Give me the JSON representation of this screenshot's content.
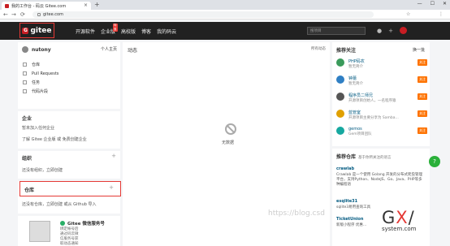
{
  "browser": {
    "tab_title": "我的工作台 - 码云 Gitee.com",
    "tab_close": "×",
    "new_tab": "+",
    "url": "gitee.com",
    "back": "←",
    "forward": "→",
    "reload": "⟳",
    "win_min": "—",
    "win_max": "☐",
    "win_close": "✕",
    "star": "☆",
    "menu": "⋮"
  },
  "header": {
    "logo_text": "gitee",
    "logo_mark": "G",
    "nav": [
      "开源软件",
      "企业版",
      "高校版",
      "博客",
      "我的码云"
    ],
    "hot_badge": "特惠",
    "search_placeholder": "搜项目",
    "bell": "🔔",
    "add": "+"
  },
  "user": {
    "name": "nutony",
    "home_link": "个人主页",
    "items": [
      "仓库",
      "Pull Requests",
      "任务",
      "代码片段"
    ]
  },
  "enterprise": {
    "title": "企业",
    "empty": "暂未加入任何企业",
    "promo": "了解 Gitee 企业版 或 免费创建企业"
  },
  "org": {
    "title": "组织",
    "empty": "还没有组织，立即创建"
  },
  "repo": {
    "title": "仓库",
    "empty": "还没有仓库，立即创建 或从 Github 导入"
  },
  "wechat": {
    "title": "Gitee 微信服务号",
    "lines": [
      "绑定帐号后",
      "通过码云微",
      "信服务号获",
      "取动态通知"
    ]
  },
  "center": {
    "title": "动态",
    "filter": "所有动态",
    "empty": "无数据",
    "watermark": "https://blog.csd"
  },
  "recommend": {
    "title": "推荐关注",
    "refresh": "换一批",
    "follow": "关注",
    "users": [
      {
        "name": "PHP码农",
        "desc": "暂无简介",
        "color": "#3a9a5b"
      },
      {
        "name": "钟蕾",
        "desc": "暂无简介",
        "color": "#2f7fc4"
      },
      {
        "name": "程序员二师兄",
        "desc": "开源项目创始人，一名程序猿",
        "color": "#555555"
      },
      {
        "name": "蓝管室",
        "desc": "开源项目主要分享为 Samba...",
        "color": "#e0a000"
      },
      {
        "name": "gemos",
        "desc": "Gem项目团队",
        "color": "#16a8a0"
      }
    ]
  },
  "recommend_repo": {
    "title": "推荐仓库",
    "subtitle": "基于你所关注的语言",
    "repos": [
      {
        "name": "crawlab",
        "desc": "Crawlab 是一个使用 Golang 开发的分布式爬虫管理平台，支持Python、NodeJS、Go、Java、PHP等多种编程语"
      },
      {
        "name": "esqlite31",
        "desc": "sqlite3易用查询工具"
      },
      {
        "name": "TicketUnion",
        "desc": "新版小程序 优惠..."
      }
    ]
  },
  "fab": "?",
  "gxi": {
    "main_a": "G",
    "main_b": "X",
    "main_c": "/",
    "sub": "system.com"
  }
}
